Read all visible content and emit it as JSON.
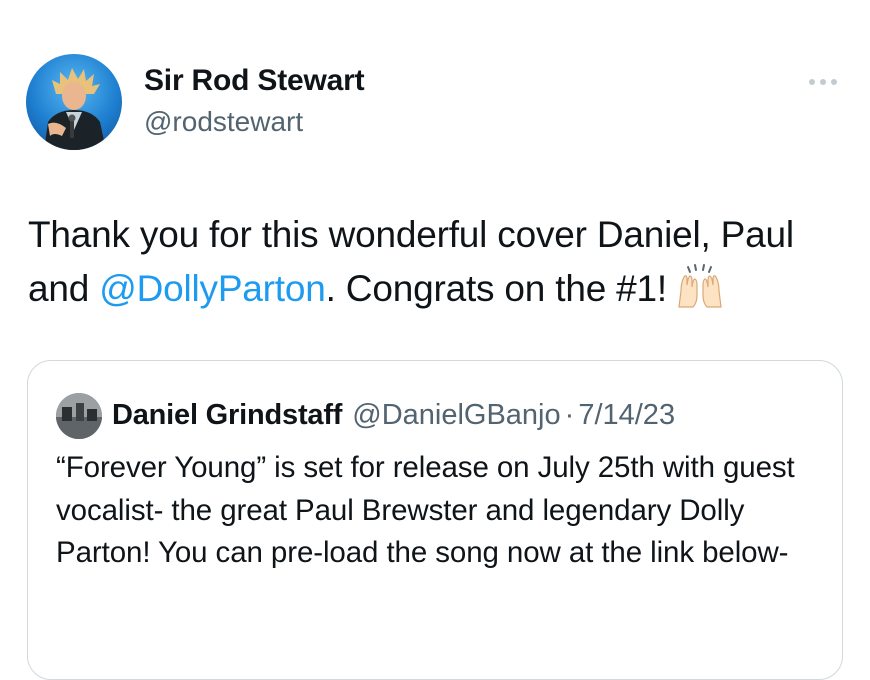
{
  "author": {
    "name": "Sir Rod Stewart",
    "handle": "@rodstewart"
  },
  "tweet": {
    "text_before": "Thank you for this wonderful cover Daniel, Paul and ",
    "mention": "@DollyParton",
    "text_after": ". Congrats on the #1!",
    "emoji": "raising-hands-emoji"
  },
  "quote": {
    "name": "Daniel Grindstaff",
    "handle": "@DanielGBanjo",
    "separator": "·",
    "date": "7/14/23",
    "text": "“Forever Young” is set for release on July 25th with guest vocalist- the great Paul Brewster and legendary Dolly Parton! You can pre-load the song now at the link below-"
  },
  "icons": {
    "more": "more-options-icon"
  },
  "colors": {
    "link": "#1d9bf0",
    "secondary_text": "#536471",
    "border": "#cfd9de",
    "text": "#0f1419"
  }
}
